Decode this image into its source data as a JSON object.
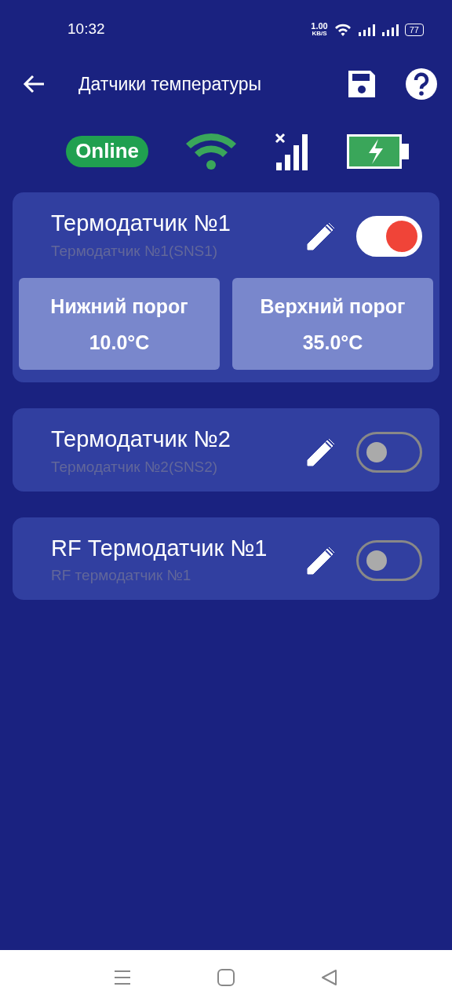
{
  "status_bar": {
    "time": "10:32",
    "net_speed": "1.00",
    "net_unit": "KB/S",
    "battery": "77"
  },
  "header": {
    "title": "Датчики температуры"
  },
  "status_row": {
    "connection": "Online"
  },
  "sensors": [
    {
      "name": "Термодатчик №1",
      "subtitle": "Термодатчик №1(SNS1)",
      "on": true,
      "thresholds": [
        {
          "label": "Нижний порог",
          "value": "10.0°C"
        },
        {
          "label": "Верхний порог",
          "value": "35.0°C"
        }
      ]
    },
    {
      "name": "Термодатчик №2",
      "subtitle": "Термодатчик №2(SNS2)",
      "on": false
    },
    {
      "name": "RF Термодатчик №1",
      "subtitle": "RF термодатчик №1",
      "on": false
    }
  ]
}
